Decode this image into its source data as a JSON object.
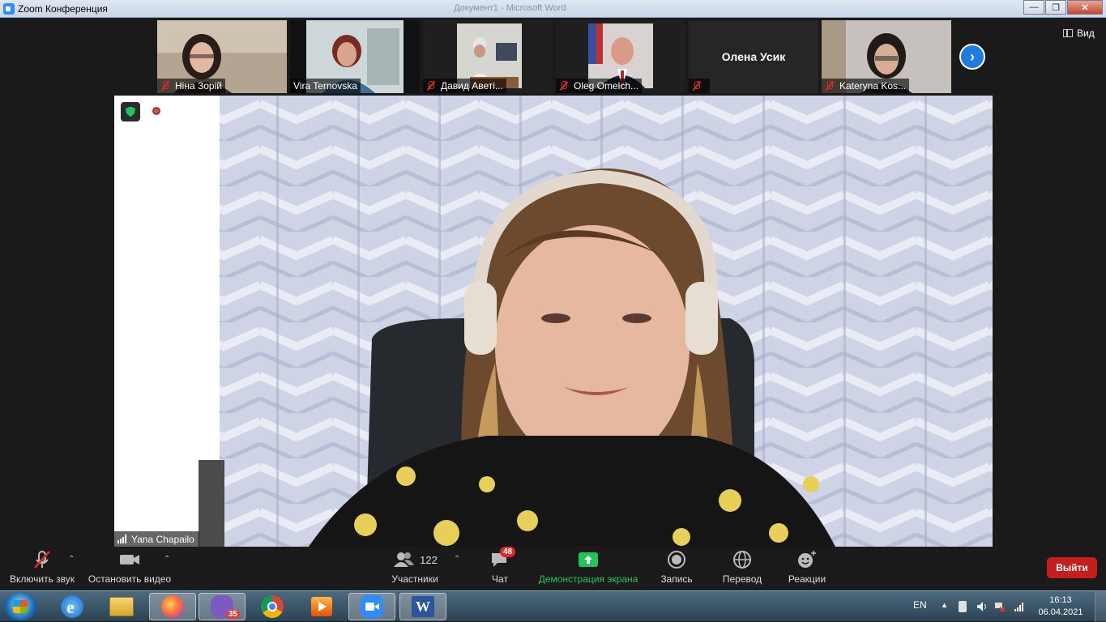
{
  "window": {
    "title": "Zoom Конференция",
    "center_title": "Документ1 - Microsoft Word"
  },
  "participants": [
    {
      "name": "Ніна Зорій",
      "muted": true
    },
    {
      "name": "Vira Ternovska",
      "muted": false
    },
    {
      "name": "Давид Аветі...",
      "muted": true
    },
    {
      "name": "Oleg Omelch...",
      "muted": true
    },
    {
      "name": "Олена Усик",
      "muted": true
    },
    {
      "name": "Kateryna Kos...",
      "muted": true
    }
  ],
  "view_label": "Вид",
  "speaker": {
    "name": "Yana Chapailo"
  },
  "toolbar": {
    "unmute": "Включить звук",
    "stop_video": "Остановить видео",
    "participants_count": "122",
    "participants": "Участники",
    "chat": "Чат",
    "chat_badge": "48",
    "share": "Демонстрация экрана",
    "record": "Запись",
    "translate": "Перевод",
    "reactions": "Реакции",
    "leave": "Выйти"
  },
  "taskbar": {
    "viber_badge": "35",
    "language": "EN",
    "time": "16:13",
    "date": "06.04.2021"
  },
  "colors": {
    "accent": "#2d8cff",
    "share_green": "#23c45a",
    "leave_red": "#c41e1e",
    "mute_red": "#e02828"
  }
}
